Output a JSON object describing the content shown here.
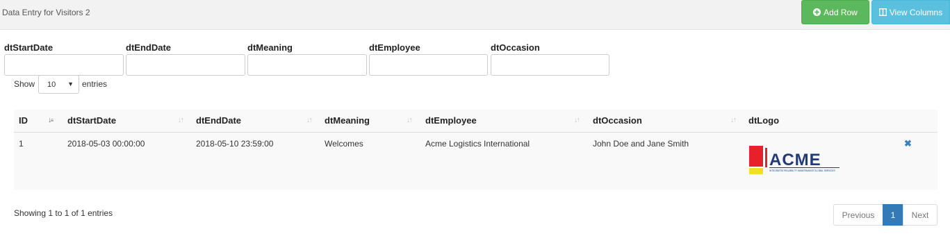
{
  "header": {
    "title": "Data Entry for Visitors 2",
    "add_row_label": "Add Row",
    "view_columns_label": "View Columns",
    "add_color": "#5cb85c",
    "view_color": "#5bc0de"
  },
  "filters": [
    {
      "label": "dtStartDate",
      "value": ""
    },
    {
      "label": "dtEndDate",
      "value": ""
    },
    {
      "label": "dtMeaning",
      "value": ""
    },
    {
      "label": "dtEmployee",
      "value": ""
    },
    {
      "label": "dtOccasion",
      "value": ""
    }
  ],
  "length": {
    "show": "Show",
    "value": "10",
    "entries": "entries"
  },
  "table": {
    "columns": [
      "ID",
      "dtStartDate",
      "dtEndDate",
      "dtMeaning",
      "dtEmployee",
      "dtOccasion",
      "dtLogo"
    ],
    "rows": [
      {
        "id": "1",
        "start": "2018-05-03 00:00:00",
        "end": "2018-05-10 23:59:00",
        "meaning": "Welcomes",
        "employee": "Acme Logistics International",
        "occasion": "John Doe and Jane Smith",
        "logo": {
          "text": "ACME",
          "tagline": "INTEGRATED RELIABILITY MAINTENANCE GLOBAL SERVICES"
        }
      }
    ]
  },
  "footer": {
    "info": "Showing 1 to 1 of 1 entries",
    "previous": "Previous",
    "current_page": "1",
    "next": "Next",
    "active_color": "#337ab7"
  }
}
